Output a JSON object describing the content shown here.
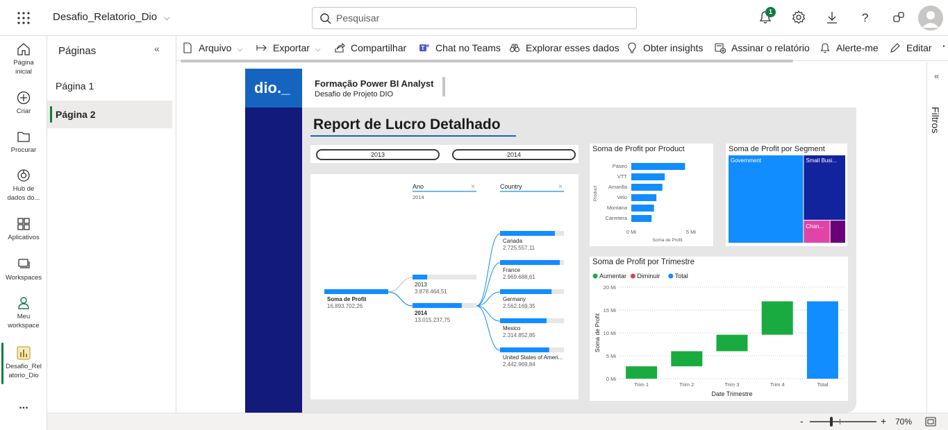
{
  "app": {
    "report_name": "Desafio_Relatorio_Dio",
    "search_placeholder": "Pesquisar",
    "notification_count": "1"
  },
  "rail": [
    {
      "label": "Página inicial",
      "icon": "home-icon"
    },
    {
      "label": "Criar",
      "icon": "create-icon"
    },
    {
      "label": "Procurar",
      "icon": "browse-icon"
    },
    {
      "label": "Hub de dados do...",
      "icon": "data-hub-icon"
    },
    {
      "label": "Aplicativos",
      "icon": "apps-icon"
    },
    {
      "label": "Workspaces",
      "icon": "workspaces-icon"
    },
    {
      "label": "Meu workspace",
      "icon": "my-workspace-icon"
    },
    {
      "label": "Desafio_Relatorio_Dio",
      "icon": "report-icon"
    },
    {
      "label": "...",
      "icon": "more-icon"
    }
  ],
  "pages_pane": {
    "title": "Páginas",
    "items": [
      {
        "label": "Página 1",
        "active": false
      },
      {
        "label": "Página 2",
        "active": true
      }
    ]
  },
  "toolbar": {
    "file": "Arquivo",
    "export": "Exportar",
    "share": "Compartilhar",
    "teams": "Chat no Teams",
    "explore": "Explorar esses dados",
    "insights": "Obter insights",
    "subscribe": "Assinar o relatório",
    "alert": "Alerte-me",
    "edit": "Editar"
  },
  "filters_pane": {
    "label": "Filtros"
  },
  "status": {
    "zoom": "70%"
  },
  "report": {
    "logo_text": "dio._",
    "header_title": "Formação Power BI Analyst",
    "header_subtitle": "Desafio de Projeto DIO",
    "page_title": "Report de Lucro Detalhado",
    "slicer": [
      "2013",
      "2014"
    ],
    "colors": {
      "sidebar": "#121a7a",
      "logo_bg": "#1565c0",
      "accent": "#118dff",
      "increase": "#1aab40",
      "decrease": "#d64550",
      "total": "#118dff"
    }
  },
  "chart_data": [
    {
      "type": "table",
      "title": "",
      "decomposition_tree": {
        "root": {
          "label": "Soma de Profit",
          "value": "16.893.702,26"
        },
        "levels": [
          {
            "field": "Ano",
            "filter": "2014",
            "nodes": [
              {
                "label": "2013",
                "value": "3.878.464,51",
                "numeric": 3878464.51
              },
              {
                "label": "2014",
                "value": "13.015.237,75",
                "numeric": 13015237.75,
                "selected": true
              }
            ]
          },
          {
            "field": "Country",
            "nodes": [
              {
                "label": "Canada",
                "value": "2.725.557,11",
                "numeric": 2725557.11
              },
              {
                "label": "France",
                "value": "2.969.688,61",
                "numeric": 2969688.61
              },
              {
                "label": "Germany",
                "value": "2.562.169,35",
                "numeric": 2562169.35
              },
              {
                "label": "Mexico",
                "value": "2.314.852,85",
                "numeric": 2314852.85
              },
              {
                "label": "United States of Ameri...",
                "value": "2.442.969,84",
                "numeric": 2442969.84
              }
            ]
          }
        ]
      }
    },
    {
      "type": "bar",
      "orientation": "horizontal",
      "title": "Soma de Profit por Product",
      "xlabel": "Soma de Profit",
      "ylabel": "Product",
      "categories": [
        "Paseo",
        "VTT",
        "Amarilla",
        "Velo",
        "Montana",
        "Carretera"
      ],
      "values": [
        4.5,
        2.8,
        2.6,
        2.1,
        1.9,
        1.7
      ],
      "xlim": [
        0,
        5
      ],
      "ticks": [
        "0 Mi",
        "5 Mi"
      ]
    },
    {
      "type": "heatmap",
      "subtype": "treemap",
      "title": "Soma de Profit por Segment",
      "segments": [
        {
          "label": "Government",
          "color": "#118dff",
          "value": 10.8
        },
        {
          "label": "Small Busi...",
          "color": "#12239e",
          "value": 4.5
        },
        {
          "label": "Chan...",
          "color": "#e044a7",
          "value": 1.0
        },
        {
          "label": "",
          "color": "#6b007b",
          "value": 0.6
        }
      ]
    },
    {
      "type": "bar",
      "subtype": "waterfall",
      "title": "Soma de Profit por Trimestre",
      "xlabel": "Date Trimestre",
      "ylabel": "Soma de Profit",
      "legend": [
        {
          "label": "Aumentar",
          "color": "#1aab40"
        },
        {
          "label": "Diminuir",
          "color": "#d64550"
        },
        {
          "label": "Total",
          "color": "#118dff"
        }
      ],
      "categories": [
        "Trim 1",
        "Trim 2",
        "Trim 3",
        "Trim 4",
        "Total"
      ],
      "steps": [
        {
          "start": 0,
          "end": 2.7
        },
        {
          "start": 2.7,
          "end": 6.0
        },
        {
          "start": 6.0,
          "end": 9.6
        },
        {
          "start": 9.6,
          "end": 16.9
        },
        {
          "start": 0,
          "end": 16.9,
          "total": true
        }
      ],
      "ylim": [
        0,
        20
      ],
      "ticks": [
        "0 Mi",
        "5 Mi",
        "10 Mi",
        "15 Mi",
        "20 Mi"
      ]
    }
  ]
}
